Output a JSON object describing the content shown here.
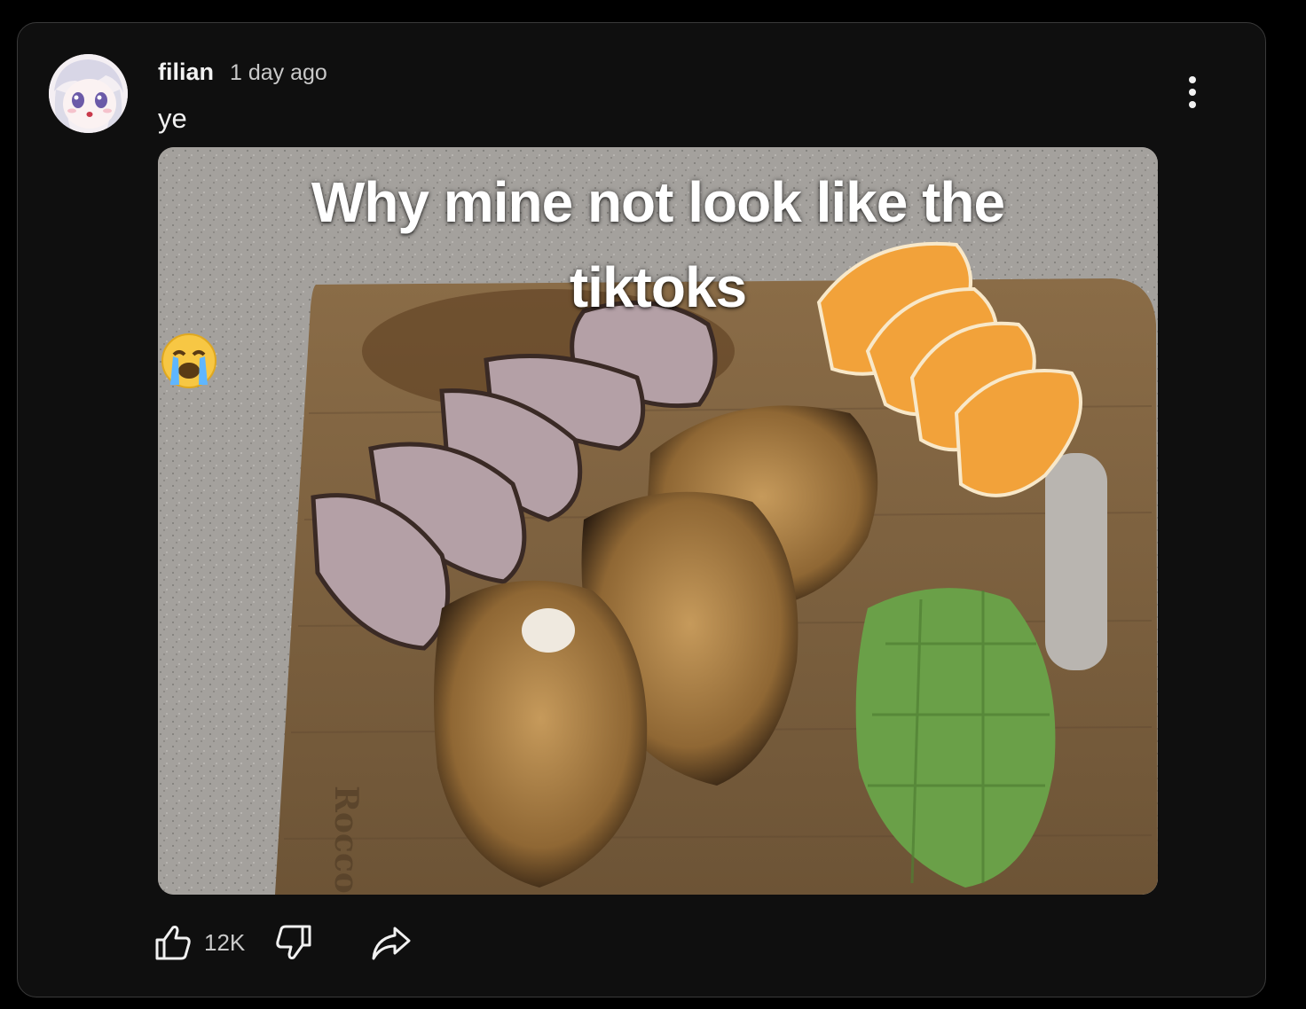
{
  "comment": {
    "author": "filian",
    "timestamp": "1 day ago",
    "text": "ye",
    "image": {
      "caption_line1": "Why mine not look like the",
      "caption_line2": "tiktoks",
      "caption_emoji": "loudly-crying-face",
      "board_brand": "Rocco"
    },
    "likes": "12K",
    "icons": {
      "menu": "more-vert-icon",
      "like": "thumb-up-icon",
      "dislike": "thumb-down-icon",
      "share": "share-icon"
    }
  },
  "colors": {
    "background": "#000000",
    "card": "#0f0f0f",
    "text_primary": "#f1f1f1",
    "text_secondary": "#c9c9c9"
  }
}
